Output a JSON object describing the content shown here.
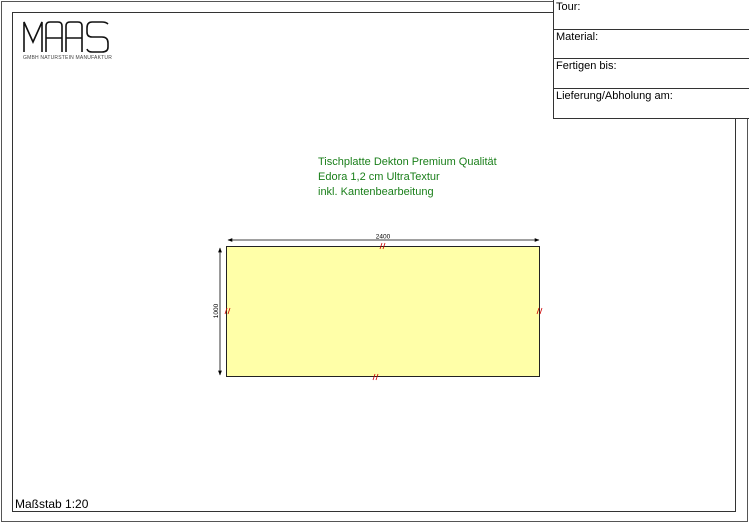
{
  "company": {
    "logo_text": "MAAS",
    "tagline": "GMBH NATURSTEIN MANUFAKTUR"
  },
  "info_fields": {
    "tour": "Tour:",
    "material": "Material:",
    "deadline": "Fertigen bis:",
    "delivery": "Lieferung/Abholung am:"
  },
  "description": {
    "line1": "Tischplatte Dekton Premium Qualität",
    "line2": "Edora 1,2 cm UltraTextur",
    "line3": "inkl. Kantenbearbeitung"
  },
  "dimensions": {
    "width": "2400",
    "height": "1000"
  },
  "scale": "Maßstab 1:20",
  "colors": {
    "panel_fill": "#ffffa8",
    "description_text": "#1a7f1a",
    "edge_mark": "#cc0000"
  }
}
